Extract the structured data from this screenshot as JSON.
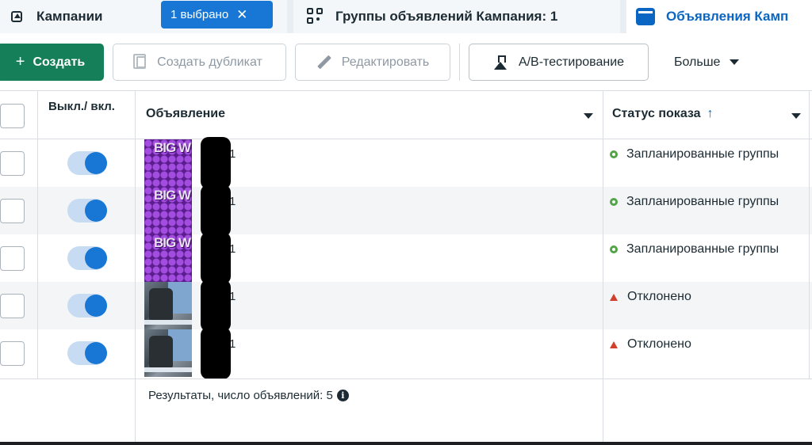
{
  "tabs": {
    "campaigns_label": "Кампании",
    "selected_chip": "1 выбрано",
    "selected_chip_close": "✕",
    "adsets_label": "Группы объявлений Кампания: 1",
    "ads_label": "Объявления Камп"
  },
  "toolbar": {
    "create_plus": "+",
    "create_label": "Создать",
    "duplicate_label": "Создать дубликат",
    "edit_label": "Редактировать",
    "ab_label": "A/B-тестирование",
    "more_label": "Больше"
  },
  "table": {
    "headers": {
      "onoff": "Выкл./ вкл.",
      "ad": "Объявление",
      "status": "Статус показа",
      "sort_arrow": "↑"
    },
    "rows": [
      {
        "name": "1",
        "status": "Запланированные группы",
        "status_kind": "scheduled",
        "thumb": "purple",
        "thumb_text": "BIG W"
      },
      {
        "name": "1",
        "status": "Запланированные группы",
        "status_kind": "scheduled",
        "thumb": "purple",
        "thumb_text": "BIG W"
      },
      {
        "name": "1",
        "status": "Запланированные группы",
        "status_kind": "scheduled",
        "thumb": "purple",
        "thumb_text": "BIG W"
      },
      {
        "name": "1",
        "status": "Отклонено",
        "status_kind": "rejected",
        "thumb": "photo",
        "thumb_text": ""
      },
      {
        "name": "1",
        "status": "Отклонено",
        "status_kind": "rejected",
        "thumb": "photo",
        "thumb_text": ""
      }
    ],
    "footer": "Результаты, число объявлений: 5",
    "footer_info": "i"
  },
  "colors": {
    "accent": "#1877d4",
    "create_green": "#157f5a",
    "status_scheduled": "#52a447",
    "status_rejected": "#d0402c"
  }
}
